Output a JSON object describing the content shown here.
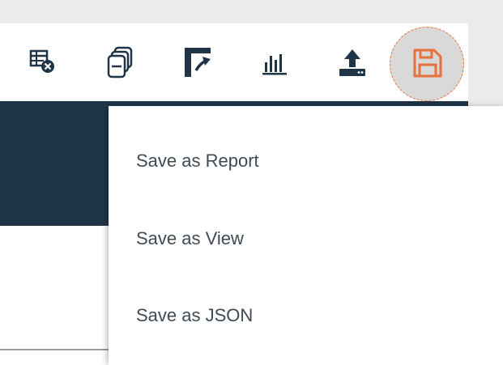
{
  "toolbar": {
    "tools": [
      {
        "name": "table-remove",
        "icon": "table-remove-icon"
      },
      {
        "name": "windows",
        "icon": "windows-icon"
      },
      {
        "name": "column-move",
        "icon": "column-move-icon"
      },
      {
        "name": "chart",
        "icon": "bar-chart-icon"
      },
      {
        "name": "upload",
        "icon": "upload-icon"
      },
      {
        "name": "save",
        "icon": "floppy-disk-icon"
      }
    ]
  },
  "dropdown": {
    "items": [
      {
        "label": "Save as Report"
      },
      {
        "label": "Save as View"
      },
      {
        "label": "Save as JSON"
      }
    ]
  },
  "colors": {
    "navy": "#1f3547",
    "accent_orange": "#e8703a",
    "menu_text": "#3f4a55",
    "icon": "#1f3547"
  }
}
